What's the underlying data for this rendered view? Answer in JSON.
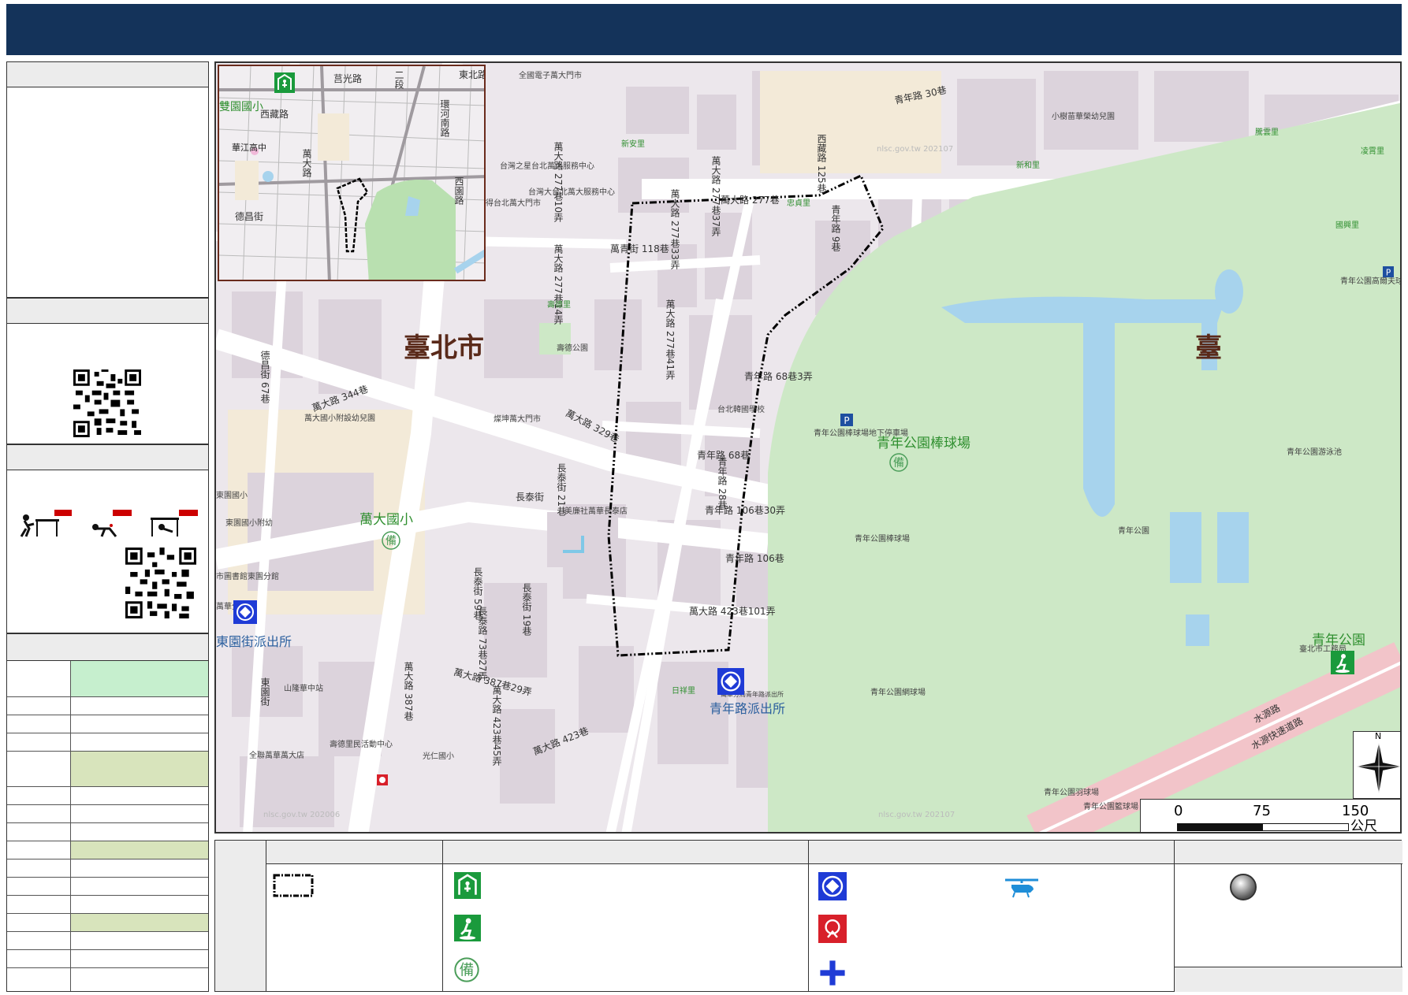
{
  "map": {
    "city_label": "臺北市",
    "partial_label": "臺",
    "place_labels": {
      "baseball": "青年公園棒球場",
      "wanda_school": "萬大國小",
      "youth_park": "青年公園",
      "police_qingnian": "青年路派出所",
      "police_dongyuan": "東園街派出所",
      "shuangyuan_school": "雙園國小",
      "huajiang": "華江高中"
    },
    "roads": {
      "qingnian_68": "青年路 68巷",
      "qingnian_106_30": "青年路 106巷30弄",
      "qingnian_106": "青年路 106巷",
      "wanda_423_101": "萬大路 423巷101弄",
      "wanda_344": "萬大路 344巷",
      "wanda_329": "萬大路 329巷",
      "wanda_387": "萬大路 387巷",
      "wanda_387_29": "萬大路 387巷29弄",
      "wanda_423": "萬大路 423巷",
      "wanchang": "長泰街",
      "wanqing_118": "萬青街 118巷",
      "qingnian_30": "青年路 30巷",
      "xizang_125": "西藏路 125巷",
      "wanda_277_10": "萬大路 277巷10弄",
      "wanda_277_14": "萬大路 277巷14弄",
      "wanda_277_33": "萬大路 277巷33弄",
      "wanda_277_37": "萬大路 277巷37弄",
      "wanda_277": "萬大路 277巷",
      "changtai_21": "長泰街 21巷",
      "changtai_19": "長泰街 19巷",
      "changtai_59": "長泰街 59巷",
      "changtai_73": "長泰街 73巷",
      "changtai_73_27": "長泰路 73巷27弄",
      "wanda_423_45": "萬大路 423巷45弄",
      "wanda_423_63": "萬大路 423巷63弄",
      "dongyuan": "東園街",
      "dexiang_67": "德昌街 67巷",
      "wanda_277_41": "萬大路 277巷41弄",
      "qingnian_68_3": "青年路 68巷3弄",
      "qingnian_28": "青年路 28巷",
      "qingnian_9": "青年路 9巷",
      "shuiyuan": "水源路",
      "shuiyuan_exp": "水源快速道路"
    },
    "pois": {
      "p1": "全國電子萬大門市",
      "p2": "台灣之星台北萬大服務中心",
      "p3": "台灣大台北萬大服務中心",
      "p4": "得台北萬大門市",
      "p5": "萬大國小附設幼兒園",
      "p6": "燦坤萬大門市",
      "p7": "美廉社萬華長泰店",
      "p8": "東園國小",
      "p9": "東園國小附幼",
      "p10": "市圖書館東園分館",
      "p11": "山隆華中站",
      "p12": "全聯萬華萬大店",
      "p13": "壽德里民活動中心",
      "p14": "光仁國小",
      "p15": "台北韓國學校",
      "p16": "青年公園棒球場地下停車場",
      "p17": "青年公園高爾夫球",
      "p18": "青年公園游泳池",
      "p19": "青年公園",
      "p20": "青年公園棒球場",
      "p21": "青年公園網球場",
      "p22": "青年公園羽球場",
      "p23": "青年公園籃球場",
      "p24": "臺北市工務局",
      "p25": "小樹苗華榮幼兒園",
      "p26": "壽德公園",
      "p27": "萬華分局",
      "p28": "東園街派出所",
      "p29": "國興里",
      "p30": "忠貞里",
      "p31": "日祥里",
      "p32": "新和里",
      "p33": "凌霄里",
      "p34": "騰雲里",
      "p35": "壽德里",
      "p36": "新安里",
      "p37": "萬華分局青年路派出所"
    },
    "watermark_a": "nlsc.gov.tw 202107",
    "watermark_b": "nlsc.gov.tw 202006",
    "scale": {
      "t0": "0",
      "t1": "75",
      "t2": "150",
      "unit": "公尺"
    },
    "north": "N",
    "inset": {
      "streets": {
        "a": "莒光路",
        "b": "西藏路",
        "c": "萬大路",
        "d": "德昌街",
        "e": "環河南路",
        "f": "西園路",
        "g": "艋舺大道",
        "h": "國興路",
        "i": "二段",
        "j": "東北路"
      }
    }
  },
  "colors": {
    "header": "#14335a",
    "highlight_green_light": "#c6efce",
    "highlight_green_mid": "#d8e4bc",
    "park": "#cde8c6",
    "boundary": "#000000"
  },
  "legend": {
    "icons": [
      "boundary-box",
      "shelter-icon",
      "outdoor-evacuation-icon",
      "backup-icon",
      "police-icon",
      "helicopter-icon",
      "fire-station-icon",
      "ambulance-icon",
      "landmark-icon"
    ]
  },
  "sidebar": {
    "table_rows": 17
  }
}
